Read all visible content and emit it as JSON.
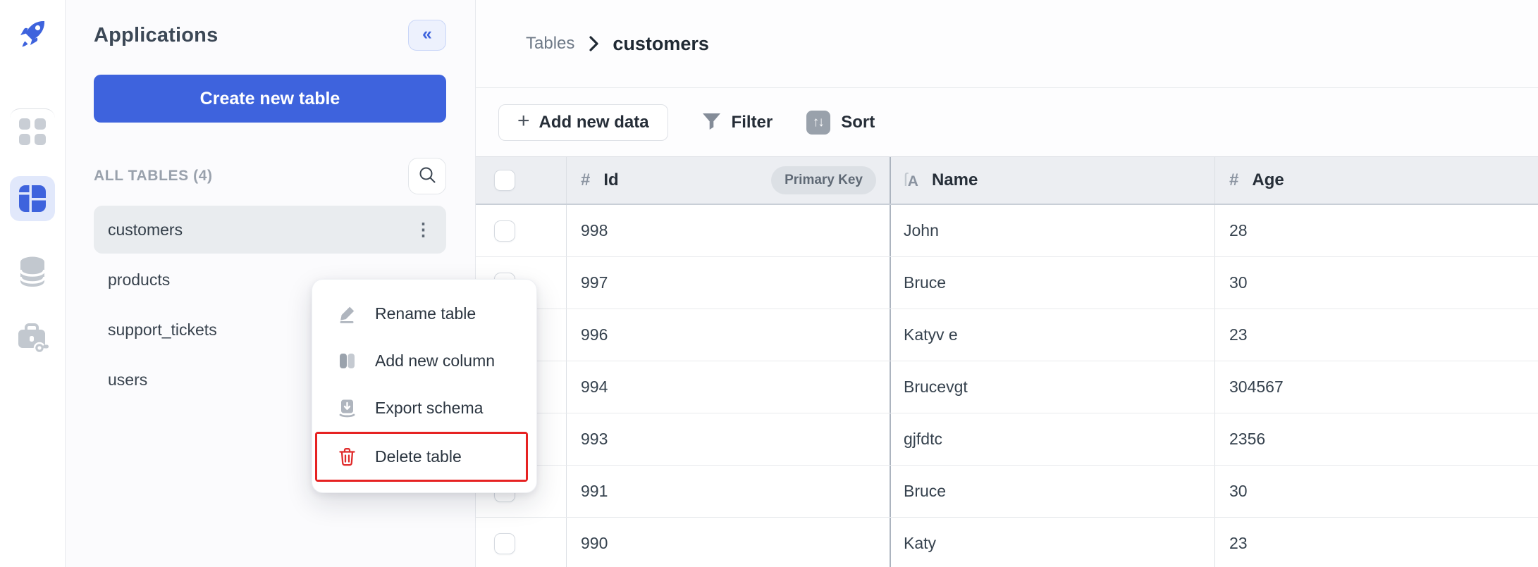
{
  "icon_rail": {
    "logo_icon": "rocket",
    "nav_icons": [
      "apps-grid",
      "table-layout-active",
      "database",
      "briefcase-key"
    ]
  },
  "sidebar": {
    "title": "Applications",
    "create_button_label": "Create new table",
    "section_label": "ALL TABLES (4)",
    "tables": [
      {
        "name": "customers",
        "selected": true
      },
      {
        "name": "products",
        "selected": false
      },
      {
        "name": "support_tickets",
        "selected": false
      },
      {
        "name": "users",
        "selected": false
      }
    ]
  },
  "icons": {
    "collapse": "«",
    "kebab": "⋮",
    "plus": "+",
    "sort_glyph": "↑↓",
    "search": "magnifier",
    "filter": "funnel"
  },
  "breadcrumb": {
    "parent": "Tables",
    "current": "customers"
  },
  "toolbar": {
    "add_button_label": "Add new data",
    "filter_label": "Filter",
    "sort_label": "Sort"
  },
  "table": {
    "columns": [
      {
        "label": "Id",
        "icon": "#",
        "badge": "Primary Key"
      },
      {
        "label": "Name",
        "icon_parts": [
          "ſ",
          "A"
        ]
      },
      {
        "label": "Age",
        "icon": "#"
      }
    ],
    "rows": [
      {
        "id": "998",
        "name": "John",
        "age": "28"
      },
      {
        "id": "997",
        "name": "Bruce",
        "age": "30"
      },
      {
        "id": "996",
        "name": "Katyv e",
        "age": "23"
      },
      {
        "id": "994",
        "name": "Brucevgt",
        "age": "304567"
      },
      {
        "id": "993",
        "name": "gjfdtc",
        "age": "2356"
      },
      {
        "id": "991",
        "name": "Bruce",
        "age": "30"
      },
      {
        "id": "990",
        "name": "Katy",
        "age": "23"
      }
    ]
  },
  "context_menu": {
    "items": [
      {
        "label": "Rename table",
        "icon": "pencil"
      },
      {
        "label": "Add new column",
        "icon": "columns"
      },
      {
        "label": "Export schema",
        "icon": "export-document"
      },
      {
        "label": "Delete table",
        "icon": "trash",
        "danger": true,
        "annotated": true
      }
    ]
  },
  "colors": {
    "accent_blue": "#3E63DD",
    "active_tile_bg": "#E1E8FB",
    "danger_red": "#E02B2B",
    "annotation_red": "#E62222",
    "selected_item_bg": "#E9ECEF",
    "table_header_bg": "#ECEEF2"
  }
}
